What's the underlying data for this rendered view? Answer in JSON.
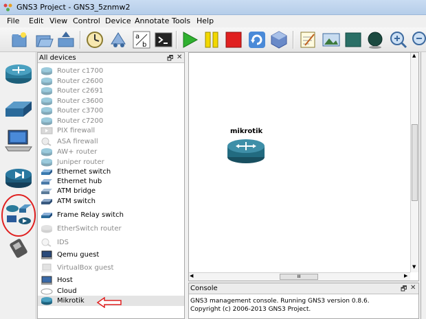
{
  "window": {
    "title": "GNS3 Project - GNS3_5znmw2"
  },
  "menu": [
    "File",
    "Edit",
    "View",
    "Control",
    "Device",
    "Annotate",
    "Tools",
    "Help"
  ],
  "toolbar": {
    "icons": [
      "new-project-icon",
      "open-folder-icon",
      "save-icon",
      "snapshot-clock-icon",
      "network-topology-icon",
      "ab-label-icon",
      "terminal-icon",
      "play-icon",
      "pause-icon",
      "stop-icon",
      "reload-icon",
      "virtualbox-icon",
      "notepad-icon",
      "picture-icon",
      "rectangle-icon",
      "ellipse-icon",
      "zoom-in-icon",
      "zoom-out-icon"
    ]
  },
  "devices_panel": {
    "title": "All devices",
    "items": [
      {
        "label": "Router c1700",
        "enabled": false,
        "icon": "router-icon"
      },
      {
        "label": "Router c2600",
        "enabled": false,
        "icon": "router-icon"
      },
      {
        "label": "Router c2691",
        "enabled": false,
        "icon": "router-icon"
      },
      {
        "label": "Router c3600",
        "enabled": false,
        "icon": "router-icon"
      },
      {
        "label": "Router c3700",
        "enabled": false,
        "icon": "router-icon"
      },
      {
        "label": "Router c7200",
        "enabled": false,
        "icon": "router-icon"
      },
      {
        "label": "PIX firewall",
        "enabled": false,
        "icon": "firewall-icon"
      },
      {
        "label": "ASA firewall",
        "enabled": false,
        "icon": "asa-icon"
      },
      {
        "label": "AW+ router",
        "enabled": false,
        "icon": "router-icon"
      },
      {
        "label": "Juniper router",
        "enabled": false,
        "icon": "router-icon"
      },
      {
        "label": "Ethernet switch",
        "enabled": true,
        "icon": "switch-icon"
      },
      {
        "label": "Ethernet hub",
        "enabled": true,
        "icon": "hub-icon"
      },
      {
        "label": "ATM bridge",
        "enabled": true,
        "icon": "atm-bridge-icon"
      },
      {
        "label": "ATM switch",
        "enabled": true,
        "icon": "atm-switch-icon"
      },
      {
        "label": "Frame Relay switch",
        "enabled": true,
        "icon": "frame-relay-icon"
      },
      {
        "label": "EtherSwitch router",
        "enabled": false,
        "icon": "etherswitch-icon"
      },
      {
        "label": "IDS",
        "enabled": false,
        "icon": "ids-icon"
      },
      {
        "label": "Qemu guest",
        "enabled": true,
        "icon": "qemu-icon"
      },
      {
        "label": "VirtualBox guest",
        "enabled": false,
        "icon": "virtualbox-guest-icon"
      },
      {
        "label": "Host",
        "enabled": true,
        "icon": "host-icon"
      },
      {
        "label": "Cloud",
        "enabled": true,
        "icon": "cloud-icon"
      },
      {
        "label": "Mikrotik",
        "enabled": true,
        "icon": "router-icon"
      }
    ]
  },
  "categories": [
    "routers-category-icon",
    "switches-category-icon",
    "end-devices-category-icon",
    "security-devices-category-icon",
    "all-devices-category-icon",
    "cable-icon"
  ],
  "canvas": {
    "node_label": "mikrotik",
    "hscroll_grip": "III"
  },
  "console": {
    "title": "Console",
    "lines": [
      "GNS3 management console. Running GNS3 version 0.8.6.",
      "Copyright (c) 2006-2013 GNS3 Project."
    ]
  },
  "panel_buttons": {
    "float": "🗗",
    "close": "✕"
  },
  "colors": {
    "accent_red": "#e02020",
    "router_teal": "#2a6f86",
    "highlight": "#e4e4e4"
  }
}
